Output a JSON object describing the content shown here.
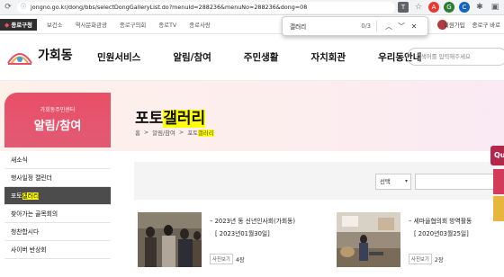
{
  "browser": {
    "url": "jongno.go.kr/dong/bbs/selectDongGalleryList.do?menuId=288236&menuNo=288236&dong=08"
  },
  "find_bar": {
    "query": "갤러리",
    "count": "0/3"
  },
  "topbar": {
    "home": "종로구청",
    "links": [
      "보건소",
      "역사문화관광",
      "종로구의회",
      "종로TV",
      "종로사랑"
    ],
    "right_links": [
      "회원가입",
      "종로구 바로"
    ]
  },
  "header": {
    "logo_text": "가회동",
    "nav": [
      "민원서비스",
      "알림/참여",
      "주민생활",
      "자치회관",
      "우리동안내"
    ],
    "search_placeholder": "검색어를 입력해주세요"
  },
  "sidebar": {
    "subtitle": "가회동주민센터",
    "title": "알림/참여",
    "items": [
      {
        "label_pre": "새소식",
        "label_hl": "",
        "active": false
      },
      {
        "label_pre": "행사일정 캘린더",
        "label_hl": "",
        "active": false
      },
      {
        "label_pre": "포토",
        "label_hl": "갤러리",
        "active": true
      },
      {
        "label_pre": "찾아가는 골목회의",
        "label_hl": "",
        "active": false
      },
      {
        "label_pre": "청찬합시다",
        "label_hl": "",
        "active": false
      },
      {
        "label_pre": "사이버 반상회",
        "label_hl": "",
        "active": false
      }
    ]
  },
  "page": {
    "title_pre": "포토",
    "title_hl": "갤러리",
    "breadcrumb": [
      "홈",
      "알림/참여",
      "포토"
    ],
    "breadcrumb_hl": "갤러리"
  },
  "filter": {
    "select_value": "선택"
  },
  "gallery": [
    {
      "title": "2023년 동 신년인사회(가회동)",
      "date": "[ 2023년01월30일]",
      "badge": "사진보기",
      "views": "4장"
    },
    {
      "title": "세마을협의회 방역활동",
      "date": "[ 2020년03월25일]",
      "badge": "사진보기",
      "views": "2장"
    }
  ],
  "floater_label": "Qu",
  "colors": {
    "accent": "#e94f67",
    "active_menu": "#4c4c4c",
    "highlight": "#ffff00"
  }
}
